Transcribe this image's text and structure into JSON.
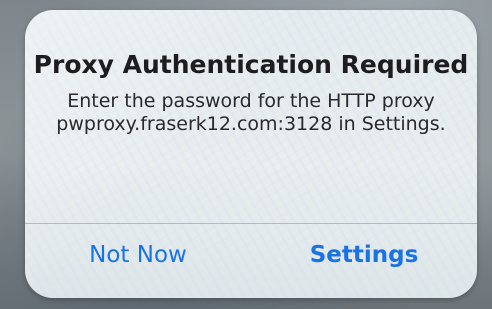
{
  "alert": {
    "title": "Proxy Authentication Required",
    "message": "Enter the password for the HTTP proxy pwproxy.fraserk12.com:3128 in Settings.",
    "buttons": {
      "cancel_label": "Not Now",
      "settings_label": "Settings"
    },
    "accent_color": "#1a73e3"
  }
}
